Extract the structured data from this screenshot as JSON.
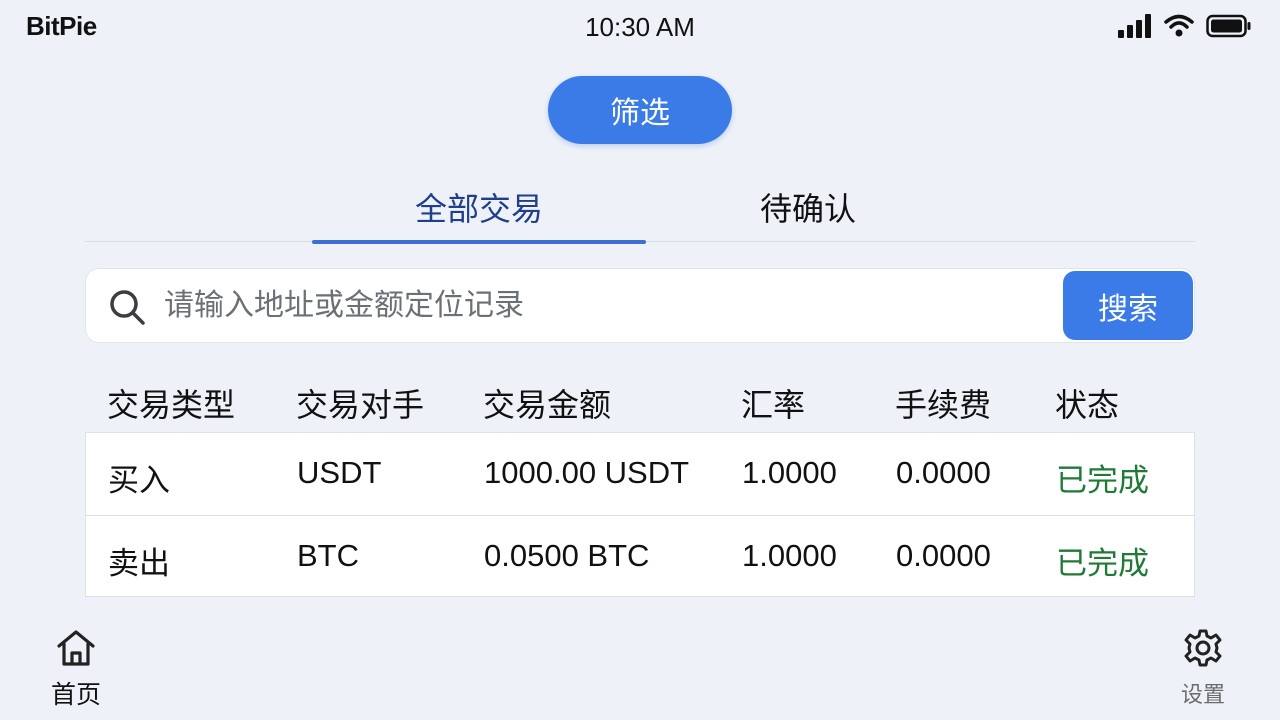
{
  "status_bar": {
    "app_name": "BitPie",
    "time": "10:30 AM",
    "icons": [
      "signal-icon",
      "wifi-icon",
      "battery-icon"
    ]
  },
  "filter": {
    "label": "筛选"
  },
  "tabs": [
    {
      "label": "全部交易",
      "active": true
    },
    {
      "label": "待确认",
      "active": false
    }
  ],
  "search": {
    "placeholder": "请输入地址或金额定位记录",
    "button_label": "搜索",
    "icon": "search-icon"
  },
  "table": {
    "headers": [
      "交易类型",
      "交易对手",
      "交易金额",
      "汇率",
      "手续费",
      "状态"
    ],
    "rows": [
      {
        "type": "买入",
        "counterparty": "USDT",
        "amount": "1000.00 USDT",
        "rate": "1.0000",
        "fee": "0.0000",
        "status": "已完成"
      },
      {
        "type": "卖出",
        "counterparty": "BTC",
        "amount": "0.0500 BTC",
        "rate": "1.0000",
        "fee": "0.0000",
        "status": "已完成"
      }
    ]
  },
  "bottom_nav": {
    "home": {
      "label": "首页",
      "icon": "home-icon"
    },
    "settings": {
      "label": "设置",
      "icon": "gear-icon"
    }
  },
  "colors": {
    "accent": "#3b7be8",
    "active_tab_text": "#1f3f8a",
    "status_done": "#1e7a34",
    "background": "#eef2f8"
  }
}
